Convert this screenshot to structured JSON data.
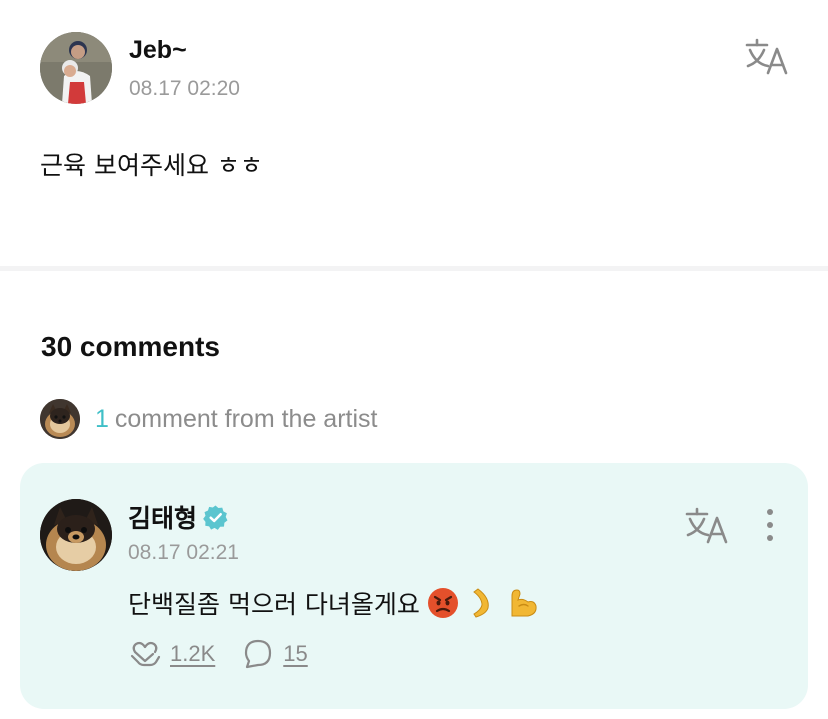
{
  "post": {
    "author": "Jeb~",
    "timestamp": "08.17 02:20",
    "body": "근육 보여주세요 ㅎㅎ",
    "translate_icon": "translate-icon"
  },
  "comments": {
    "title": "30 comments",
    "artist_filter": {
      "count": "1",
      "label": "comment from the artist"
    },
    "artist_comment": {
      "author": "김태형",
      "verified_icon": "verified-badge-icon",
      "timestamp": "08.17 02:21",
      "body": "단백질좀 먹으러 다녀올게요",
      "emojis": [
        "angry-face-emoji",
        "leg-emoji",
        "flexed-biceps-emoji"
      ],
      "likes": "1.2K",
      "replies": "15"
    }
  },
  "colors": {
    "accent": "#3fbfc7",
    "card_background": "#e9f8f6",
    "muted_text": "#9a9a9a",
    "verified": "#5bc5cf"
  }
}
